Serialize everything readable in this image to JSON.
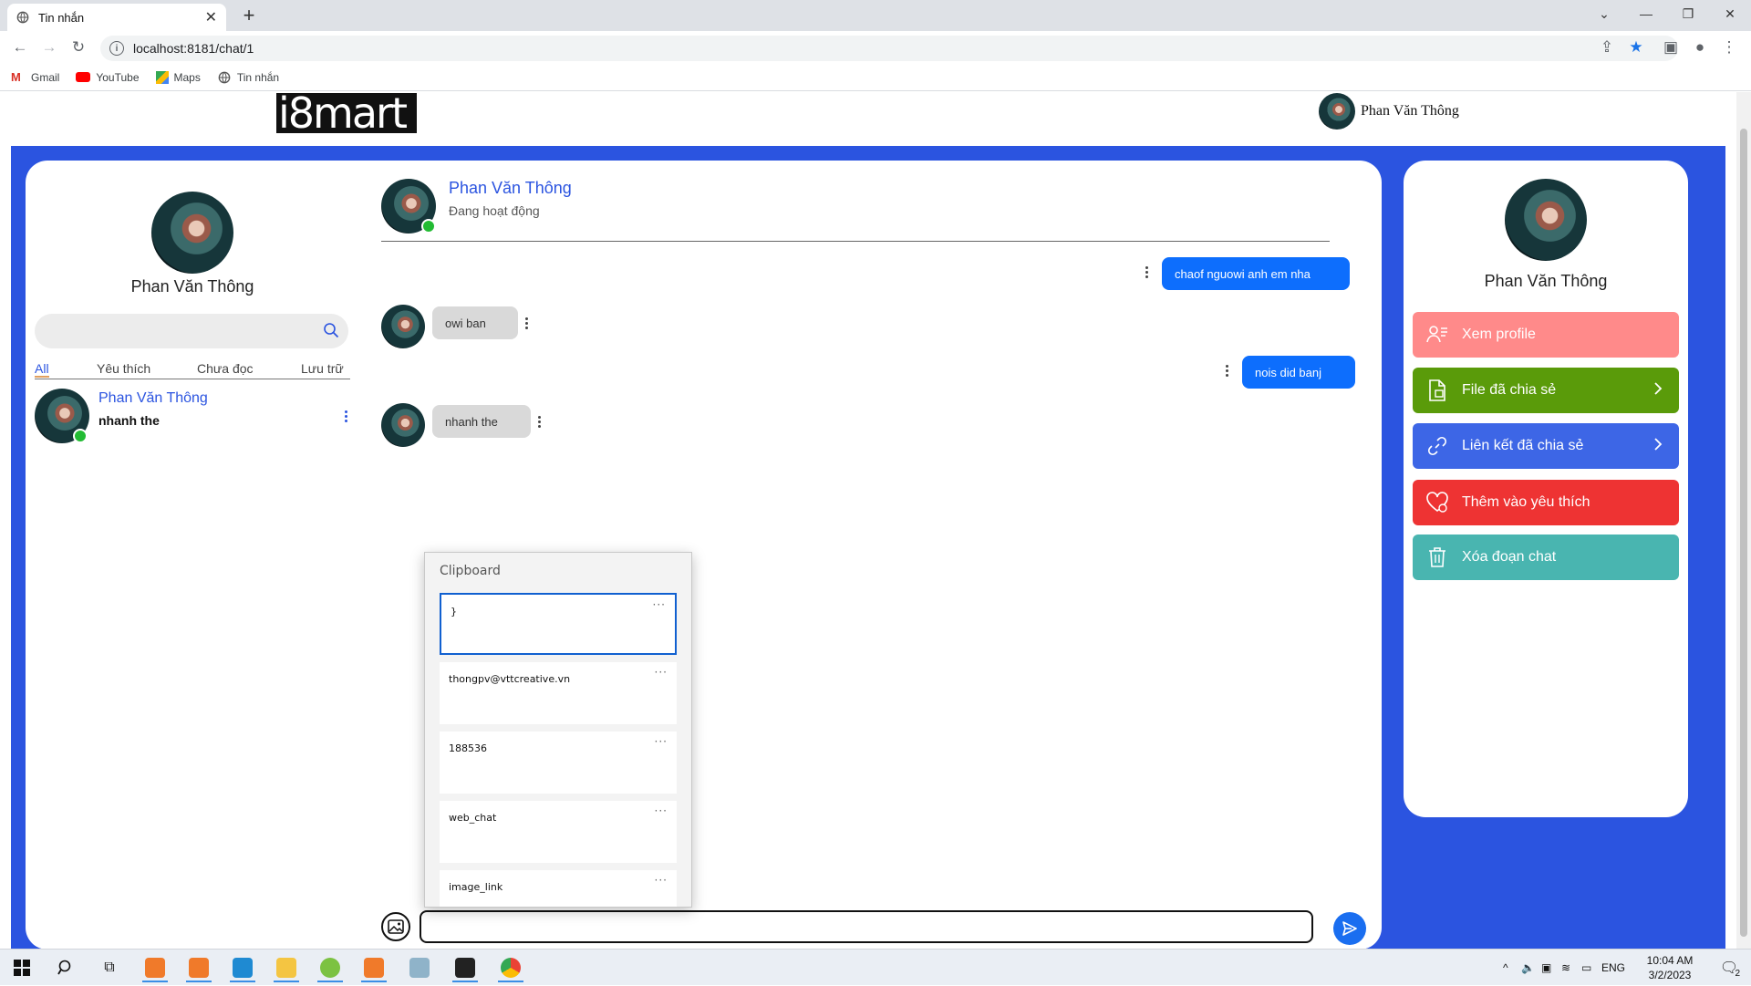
{
  "browser": {
    "tab_title": "Tin nhắn",
    "url": "localhost:8181/chat/1",
    "bookmarks": [
      "Gmail",
      "YouTube",
      "Maps",
      "Tin nhắn"
    ]
  },
  "header": {
    "logo_text": "i8mart",
    "user_name": "Phan Văn Thông"
  },
  "sidebar": {
    "profile_name": "Phan Văn Thông",
    "search_placeholder": "",
    "tabs": [
      "All",
      "Yêu thích",
      "Chưa đọc",
      "Lưu trữ"
    ],
    "conversations": [
      {
        "name": "Phan Văn Thông",
        "last_message": "nhanh the"
      }
    ]
  },
  "chat": {
    "contact_name": "Phan Văn Thông",
    "status": "Đang hoạt động",
    "messages": [
      {
        "from": "me",
        "text": "chaof nguowi anh em nha"
      },
      {
        "from": "them",
        "text": "owi ban"
      },
      {
        "from": "me",
        "text": "nois did banj"
      },
      {
        "from": "them",
        "text": "nhanh the"
      }
    ],
    "input_value": ""
  },
  "profile_panel": {
    "name": "Phan Văn Thông",
    "actions": [
      {
        "label": "Xem profile",
        "color": "#ff8a8a"
      },
      {
        "label": "File đã chia sẻ",
        "color": "#5a9b0a"
      },
      {
        "label": "Liên kết đã chia sẻ",
        "color": "#3d66e6"
      },
      {
        "label": "Thêm vào yêu thích",
        "color": "#ee3333"
      },
      {
        "label": "Xóa đoạn chat",
        "color": "#49b5b0"
      }
    ]
  },
  "clipboard": {
    "title": "Clipboard",
    "items": [
      "}",
      "thongpv@vttcreative.vn",
      "188536",
      "web_chat",
      "image_link"
    ]
  },
  "taskbar": {
    "language": "ENG",
    "time": "10:04 AM",
    "date": "3/2/2023",
    "notification_count": "2"
  }
}
